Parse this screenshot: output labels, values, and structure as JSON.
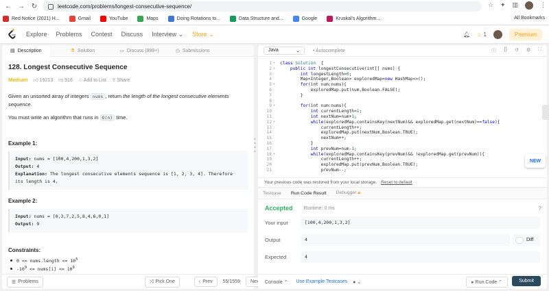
{
  "browser": {
    "url": "leetcode.com/problems/longest-consecutive-sequence/",
    "bookmarks": [
      {
        "label": "Red Notice (2021) H...",
        "color": "#d32f2f"
      },
      {
        "label": "Gmail",
        "color": "#ea4335"
      },
      {
        "label": "YouTube",
        "color": "#ff0000"
      },
      {
        "label": "Maps",
        "color": "#34a853"
      },
      {
        "label": "Doing Rotations to...",
        "color": "#3c78d8"
      },
      {
        "label": "Data Structure and...",
        "color": "#0f9d58"
      },
      {
        "label": "Google",
        "color": "#4285f4"
      },
      {
        "label": "Kruskal's Algorithm...",
        "color": "#c2185b"
      }
    ],
    "all_bookmarks": "All Bookmarks"
  },
  "nav": {
    "items": [
      "Explore",
      "Problems",
      "Contest",
      "Discuss",
      "Interview"
    ],
    "store": "Store",
    "streak": "1",
    "premium": "Premium"
  },
  "left_tabs": [
    {
      "label": "Description",
      "icon": "description-icon"
    },
    {
      "label": "Solution",
      "icon": "flask-icon"
    },
    {
      "label": "Discuss (999+)",
      "icon": "chat-icon"
    },
    {
      "label": "Submissions",
      "icon": "history-icon"
    }
  ],
  "problem": {
    "title": "128. Longest Consecutive Sequence",
    "difficulty": "Medium",
    "likes": "19213",
    "dislikes": "916",
    "add_to_list": "Add to List",
    "share": "Share",
    "p1_a": "Given an unsorted array of integers ",
    "p1_code": "nums",
    "p1_b": ", return ",
    "p1_em": "the length of the longest consecutive elements sequence.",
    "p2_a": "You must write an algorithm that runs in ",
    "p2_code": "O(n)",
    "p2_b": " time.",
    "examples": [
      {
        "heading": "Example 1:",
        "input_label": "Input:",
        "input": "nums = [100,4,200,1,3,2]",
        "output_label": "Output:",
        "output": "4",
        "expl_label": "Explanation:",
        "expl": "The longest consecutive elements sequence is [1, 2, 3, 4]. Therefore its length is 4."
      },
      {
        "heading": "Example 2:",
        "input_label": "Input:",
        "input": "nums = [0,3,7,2,5,8,4,6,0,1]",
        "output_label": "Output:",
        "output": "9"
      }
    ],
    "constraints_heading": "Constraints:",
    "constraints": [
      {
        "pre": "0 <= nums.length <= 10",
        "sup": "5"
      },
      {
        "pre": "-10",
        "sup1": "9",
        "mid": " <= nums[i] <= 10",
        "sup": "9"
      }
    ]
  },
  "left_footer": {
    "problems": "Problems",
    "pick_one": "Pick One",
    "prev": "Prev",
    "page": "55/1559",
    "next": "Next"
  },
  "editor": {
    "language": "Java",
    "autocomplete": "Autocomplete",
    "lines": [
      {
        "n": "1",
        "f": "▾",
        "t": [
          [
            "kw",
            "class "
          ],
          [
            "tp",
            "Solution"
          ],
          [
            "",
            "  {"
          ]
        ]
      },
      {
        "n": "2",
        "f": "▾",
        "t": [
          [
            "",
            "    "
          ],
          [
            "kw",
            "public int "
          ],
          [
            "",
            "longestConsecutive(int[] nums) {"
          ]
        ]
      },
      {
        "n": "3",
        "f": "",
        "t": [
          [
            "",
            "        "
          ],
          [
            "kw",
            "int "
          ],
          [
            "",
            "longestLength="
          ],
          [
            "num",
            "0"
          ],
          [
            "",
            ";"
          ]
        ]
      },
      {
        "n": "4",
        "f": "",
        "t": [
          [
            "",
            "        Map<Integer,Boolean> exploredMap="
          ],
          [
            "kw",
            "new "
          ],
          [
            "",
            "HashMap<>();"
          ]
        ]
      },
      {
        "n": "5",
        "f": "▾",
        "t": [
          [
            "",
            "        "
          ],
          [
            "kw",
            "for"
          ],
          [
            "",
            "(int num:nums){"
          ]
        ]
      },
      {
        "n": "6",
        "f": "",
        "t": [
          [
            "",
            "            exploredMap.put(num,Boolean.FALSE);"
          ]
        ]
      },
      {
        "n": "7",
        "f": "",
        "t": [
          [
            "",
            "        }"
          ]
        ]
      },
      {
        "n": "8",
        "f": "",
        "t": [
          [
            "",
            ""
          ]
        ]
      },
      {
        "n": "9",
        "f": "▾",
        "t": [
          [
            "",
            "        "
          ],
          [
            "kw",
            "for"
          ],
          [
            "",
            "(int num:nums){"
          ]
        ]
      },
      {
        "n": "10",
        "f": "",
        "t": [
          [
            "",
            "            "
          ],
          [
            "kw",
            "int "
          ],
          [
            "",
            "currentLength="
          ],
          [
            "num",
            "1"
          ],
          [
            "",
            ";"
          ]
        ]
      },
      {
        "n": "11",
        "f": "",
        "t": [
          [
            "",
            "            "
          ],
          [
            "kw",
            "int "
          ],
          [
            "",
            "nextNum=num+"
          ],
          [
            "num",
            "1"
          ],
          [
            "",
            ";"
          ]
        ]
      },
      {
        "n": "12",
        "f": "▾",
        "t": [
          [
            "",
            "            "
          ],
          [
            "kw",
            "while"
          ],
          [
            "",
            "(exploredMap.containsKey(nextNum)&& exploredMap.get(nextNum)=="
          ],
          [
            "kw",
            "false"
          ],
          [
            "",
            "){"
          ]
        ]
      },
      {
        "n": "13",
        "f": "",
        "t": [
          [
            "",
            "                currentLength++;"
          ]
        ]
      },
      {
        "n": "14",
        "f": "",
        "t": [
          [
            "",
            "                exploredMap.put(nextNum,Boolean.TRUE);"
          ]
        ]
      },
      {
        "n": "15",
        "f": "",
        "t": [
          [
            "",
            "                nextNum++;"
          ]
        ]
      },
      {
        "n": "16",
        "f": "",
        "t": [
          [
            "",
            "            }"
          ]
        ]
      },
      {
        "n": "17",
        "f": "",
        "t": [
          [
            "",
            "            "
          ],
          [
            "kw",
            "int "
          ],
          [
            "",
            "prevNum=num-"
          ],
          [
            "num",
            "1"
          ],
          [
            "",
            ";"
          ]
        ]
      },
      {
        "n": "18",
        "f": "▾",
        "t": [
          [
            "",
            "            "
          ],
          [
            "kw",
            "while"
          ],
          [
            "",
            "(exploredMap.containsKey(prevNum)&& !exploredMap.get(prevNum)){"
          ]
        ]
      },
      {
        "n": "19",
        "f": "",
        "t": [
          [
            "",
            "                currentLength++;"
          ]
        ]
      },
      {
        "n": "20",
        "f": "",
        "t": [
          [
            "",
            "                exploredMap.put(prevNum,Boolean.TRUE);"
          ]
        ]
      },
      {
        "n": "21",
        "f": "",
        "t": [
          [
            "",
            "                prevNum--;"
          ]
        ]
      }
    ]
  },
  "restore": {
    "text": "Your previous code was restored from your local storage.",
    "link": "Reset to default"
  },
  "result_tabs": [
    "Testcase",
    "Run Code Result",
    "Debugger"
  ],
  "result": {
    "status": "Accepted",
    "runtime": "Runtime: 0 ms",
    "your_input_label": "Your input",
    "your_input": "[100,4,200,1,3,2]",
    "output_label": "Output",
    "output": "4",
    "diff": "Diff",
    "expected_label": "Expected",
    "expected": "4"
  },
  "right_footer": {
    "console": "Console",
    "use_example": "Use Example Testcases",
    "run_code": "Run Code",
    "submit": "Submit"
  },
  "new_badge": "NEW",
  "colors": {
    "accent": "#ffa116",
    "accepted": "#2db55d",
    "submit": "#2b4a5d",
    "medium": "#ffb800"
  }
}
